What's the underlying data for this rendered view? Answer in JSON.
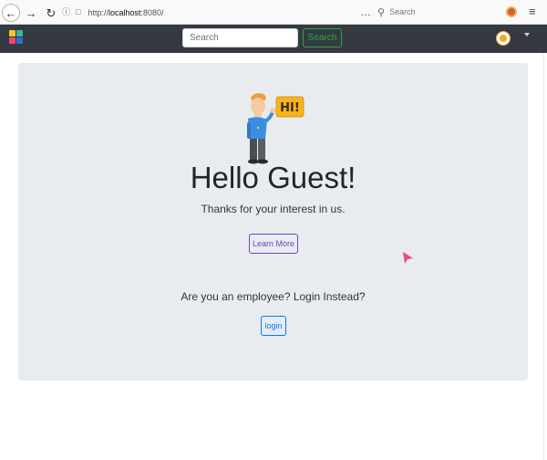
{
  "browser": {
    "url_prefix": "http://",
    "url_host": "localhost",
    "url_port": ":8080/",
    "page_actions": "…",
    "search_placeholder": "Search",
    "icons": {
      "back": "arrow-left-icon",
      "forward": "arrow-right-icon",
      "reload": "reload-icon",
      "info": "info-icon",
      "page": "page-icon",
      "search": "search-icon",
      "menu": "hamburger-menu-icon"
    }
  },
  "navbar": {
    "search_placeholder": "Search",
    "search_button_label": "Search",
    "colors": {
      "background": "#343a40",
      "search_accent": "#28a745",
      "avatar": "#f5a623"
    }
  },
  "main": {
    "speech_bubble": "HI!",
    "greeting": "Hello Guest!",
    "tagline": "Thanks for your interest in us.",
    "learn_more_label": "Learn More",
    "employee_prompt": "Are you an employee? Login Instead?",
    "login_label": "login",
    "colors": {
      "jumbotron": "#e9ecef",
      "learn_more": "#6f42c1",
      "login": "#007bff",
      "cursor": "#e8488a"
    }
  }
}
